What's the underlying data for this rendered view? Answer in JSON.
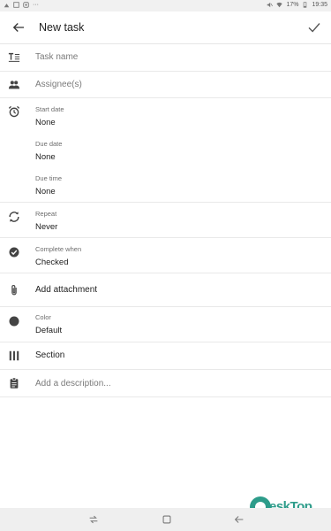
{
  "status_bar": {
    "battery": "17%",
    "time": "19:35",
    "more": "···"
  },
  "header": {
    "title": "New task"
  },
  "form": {
    "task_name": {
      "placeholder": "Task name"
    },
    "assignee": {
      "placeholder": "Assignee(s)"
    },
    "start_date": {
      "label": "Start date",
      "value": "None"
    },
    "due_date": {
      "label": "Due date",
      "value": "None"
    },
    "due_time": {
      "label": "Due time",
      "value": "None"
    },
    "repeat": {
      "label": "Repeat",
      "value": "Never"
    },
    "complete_when": {
      "label": "Complete when",
      "value": "Checked"
    },
    "attachment": {
      "text": "Add attachment"
    },
    "color": {
      "label": "Color",
      "value": "Default"
    },
    "section": {
      "text": "Section"
    },
    "description": {
      "placeholder": "Add a description..."
    }
  },
  "watermark": {
    "text": "eskTop"
  },
  "colors": {
    "icon": "#444444",
    "divider": "#e9e9e9",
    "watermark": "#2d9c8a"
  }
}
